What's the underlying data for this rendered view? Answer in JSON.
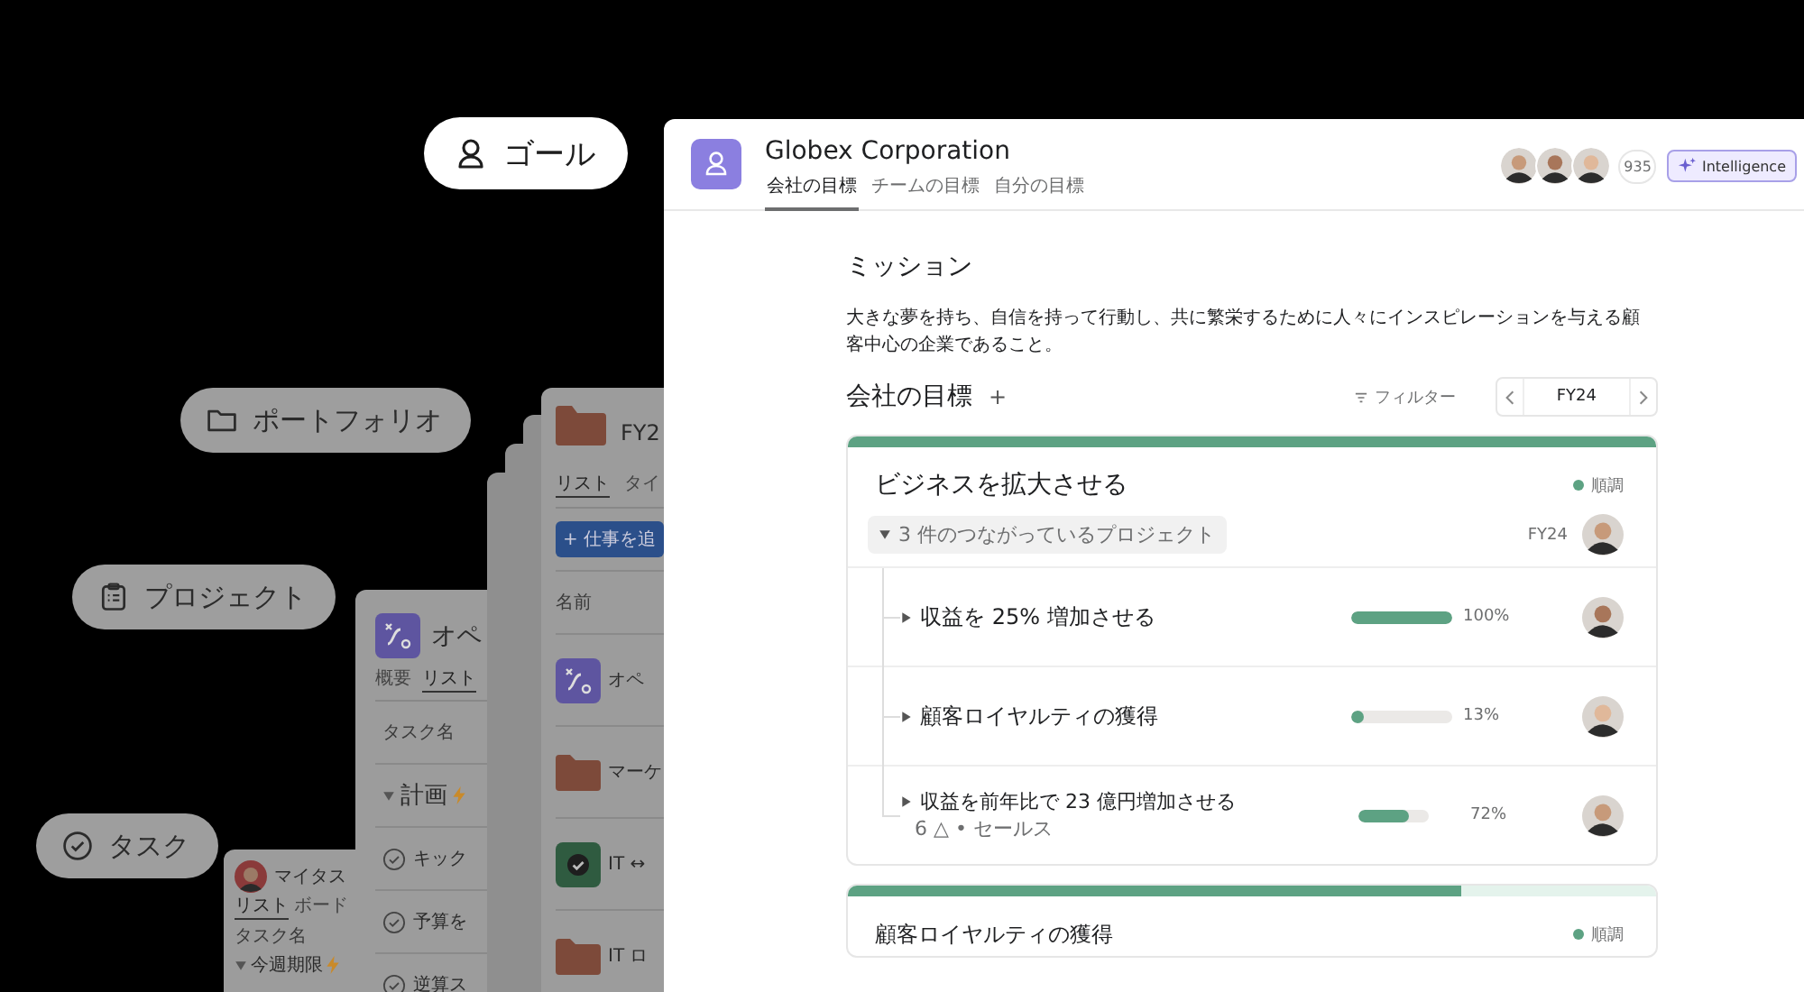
{
  "nav_pills": [
    {
      "label": "ゴール",
      "kind": "goal",
      "selected": true
    },
    {
      "label": "ポートフォリオ",
      "kind": "portfolio",
      "selected": false
    },
    {
      "label": "プロジェクト",
      "kind": "project",
      "selected": false
    },
    {
      "label": "タスク",
      "kind": "task",
      "selected": false
    }
  ],
  "portfolio_card": {
    "title": "FY2",
    "tabs": [
      {
        "label": "リスト",
        "selected": true
      },
      {
        "label": "タイ",
        "selected": false
      }
    ],
    "add_button": "+ 仕事を追",
    "column": "名前",
    "rows": [
      {
        "kind": "project",
        "name": "オペ"
      },
      {
        "kind": "folder",
        "name": "マーケ"
      },
      {
        "kind": "done",
        "name": "IT ↔"
      },
      {
        "kind": "folder",
        "name": "IT ロ"
      }
    ]
  },
  "project_card": {
    "title": "オペ",
    "tabs": [
      {
        "label": "概要",
        "selected": false
      },
      {
        "label": "リスト",
        "selected": true
      }
    ],
    "column": "タスク名",
    "section": "計画",
    "tasks": [
      "キック",
      "予算を",
      "逆算ス"
    ]
  },
  "task_card": {
    "title": "マイタス",
    "tabs": [
      {
        "label": "リスト",
        "selected": true
      },
      {
        "label": "ボード",
        "selected": false
      }
    ],
    "column": "タスク名",
    "section": "今週期限"
  },
  "window": {
    "title": "Globex Corporation",
    "tabs": [
      {
        "label": "会社の目標",
        "selected": true
      },
      {
        "label": "チームの目標",
        "selected": false
      },
      {
        "label": "自分の目標",
        "selected": false
      }
    ],
    "member_count": "935",
    "intelligence_button": "Intelligence"
  },
  "mission": {
    "heading": "ミッション",
    "text": "大きな夢を持ち、自信を持って行動し、共に繁栄するために人々にインスピレーションを与える顧客中心の企業であること。"
  },
  "goals": {
    "heading": "会社の目標",
    "add": "+",
    "filter": "フィルター",
    "period": "FY24"
  },
  "goal_cards": [
    {
      "title": "ビジネスを拡大させる",
      "level": 1,
      "status": "順調",
      "projects_label": "3 件のつながっているプロジェクト",
      "expanded": true,
      "period": "FY24",
      "subgoals": [
        {
          "title": "収益を 25% 増加させる",
          "level": 1,
          "reading": "100%"
        },
        {
          "title": "顧客ロイヤルティの獲得",
          "level": 0.13,
          "reading": "13%"
        },
        {
          "title": "収益を前年比で 23 億円増加させる",
          "meta": "6 △ • セールス",
          "level": 0.72,
          "reading": "72%"
        }
      ]
    },
    {
      "title": "顧客ロイヤルティの獲得",
      "level": 0.76,
      "status": "順調"
    }
  ]
}
